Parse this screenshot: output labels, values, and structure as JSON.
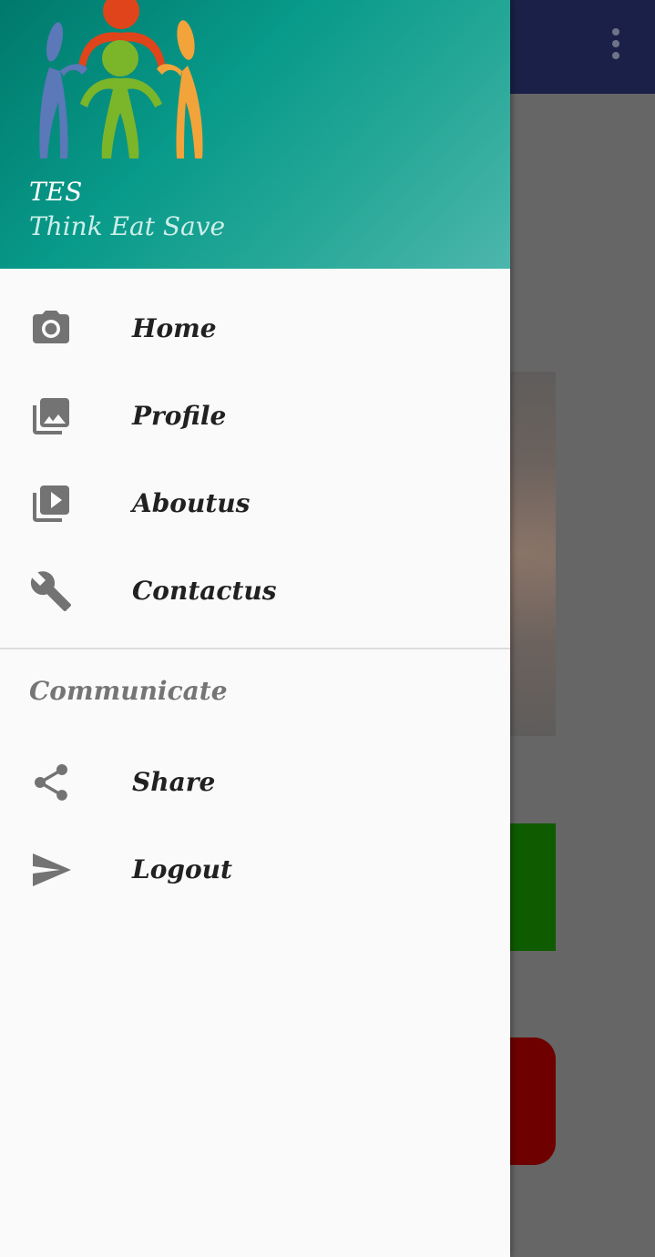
{
  "header": {
    "title": "TES",
    "subtitle": "Think Eat Save",
    "logo_icon": "people-circle-logo"
  },
  "menu": {
    "items": [
      {
        "label": "Home",
        "icon": "camera-icon"
      },
      {
        "label": "Profile",
        "icon": "gallery-icon"
      },
      {
        "label": "Aboutus",
        "icon": "slideshow-icon"
      },
      {
        "label": "Contactus",
        "icon": "wrench-icon"
      }
    ]
  },
  "communicate": {
    "title": "Communicate",
    "items": [
      {
        "label": "Share",
        "icon": "share-icon"
      },
      {
        "label": "Logout",
        "icon": "send-icon"
      }
    ]
  },
  "colors": {
    "header_gradient_start": "#00796b",
    "header_gradient_end": "#4db6ac",
    "icon_gray": "#737373",
    "text_dark": "#212121",
    "app_bar_dimmed": "#1b2048",
    "scrim": "#666666"
  }
}
